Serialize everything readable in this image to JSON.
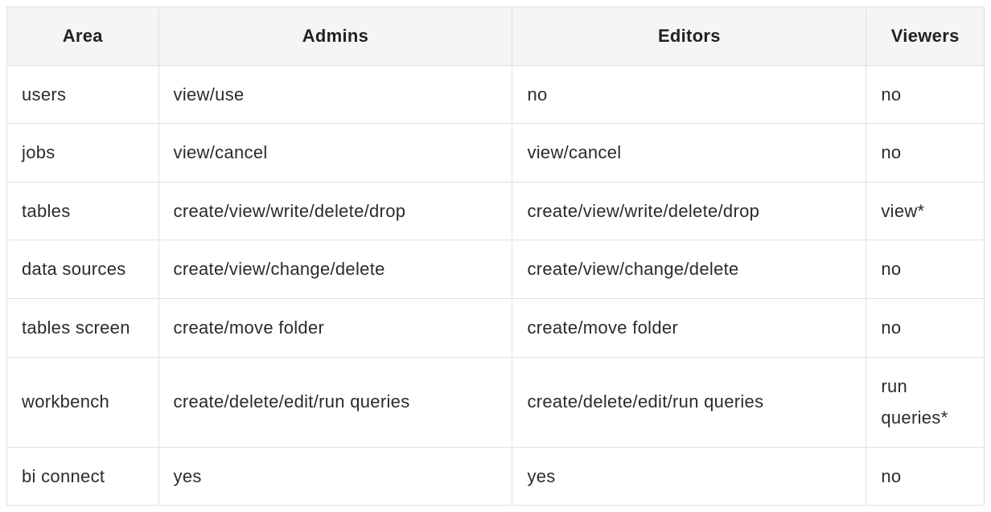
{
  "table": {
    "headers": [
      "Area",
      "Admins",
      "Editors",
      "Viewers"
    ],
    "rows": [
      {
        "area": "users",
        "admins": "view/use",
        "editors": "no",
        "viewers": "no"
      },
      {
        "area": "jobs",
        "admins": "view/cancel",
        "editors": "view/cancel",
        "viewers": "no"
      },
      {
        "area": "tables",
        "admins": "create/view/write/delete/drop",
        "editors": "create/view/write/delete/drop",
        "viewers": "view*"
      },
      {
        "area": "data sources",
        "admins": "create/view/change/delete",
        "editors": "create/view/change/delete",
        "viewers": "no"
      },
      {
        "area": "tables screen",
        "admins": "create/move folder",
        "editors": "create/move folder",
        "viewers": "no"
      },
      {
        "area": "workbench",
        "admins": "create/delete/edit/run queries",
        "editors": "create/delete/edit/run queries",
        "viewers": "run queries*"
      },
      {
        "area": "bi connect",
        "admins": "yes",
        "editors": "yes",
        "viewers": "no"
      }
    ]
  }
}
